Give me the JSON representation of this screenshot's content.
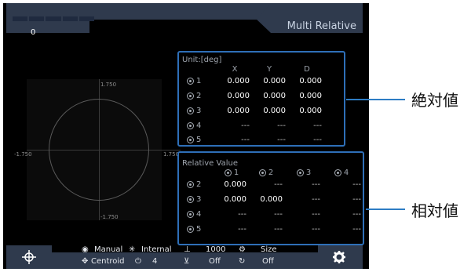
{
  "header": {
    "counter_value": "0",
    "mode_title": "Multi Relative"
  },
  "graph": {
    "label_top": "1.750",
    "label_bottom": "-1.750",
    "label_left": "-1.750",
    "label_right": "1.750"
  },
  "absolute_panel": {
    "unit_label": "Unit:[deg]",
    "columns": [
      "X",
      "Y",
      "D"
    ],
    "rows": [
      {
        "index": "1",
        "x": "0.000",
        "y": "0.000",
        "d": "0.000"
      },
      {
        "index": "2",
        "x": "0.000",
        "y": "0.000",
        "d": "0.000"
      },
      {
        "index": "3",
        "x": "0.000",
        "y": "0.000",
        "d": "0.000"
      },
      {
        "index": "4",
        "x": "---",
        "y": "---",
        "d": "---"
      },
      {
        "index": "5",
        "x": "---",
        "y": "---",
        "d": "---"
      }
    ]
  },
  "relative_panel": {
    "title": "Relative Value",
    "columns": [
      "1",
      "2",
      "3",
      "4"
    ],
    "rows": [
      {
        "index": "2",
        "c1": "0.000",
        "c2": "---",
        "c3": "---",
        "c4": "---"
      },
      {
        "index": "3",
        "c1": "0.000",
        "c2": "0.000",
        "c3": "---",
        "c4": "---"
      },
      {
        "index": "4",
        "c1": "---",
        "c2": "---",
        "c3": "---",
        "c4": "---"
      },
      {
        "index": "5",
        "c1": "---",
        "c2": "---",
        "c3": "---",
        "c4": "---"
      }
    ]
  },
  "footer": {
    "row1": {
      "mode": "Manual",
      "light": "Internal",
      "exposure": "1000",
      "size": "Size"
    },
    "row2": {
      "detect": "Centroid",
      "timer": "4",
      "filter1": "Off",
      "filter2": "Off"
    }
  },
  "annotations": {
    "absolute": "絶対値",
    "relative": "相対値"
  },
  "colors": {
    "panel_border": "#2e6fb8",
    "header_bg": "#2f3a4d",
    "annotation_line": "#2e7dc4"
  }
}
